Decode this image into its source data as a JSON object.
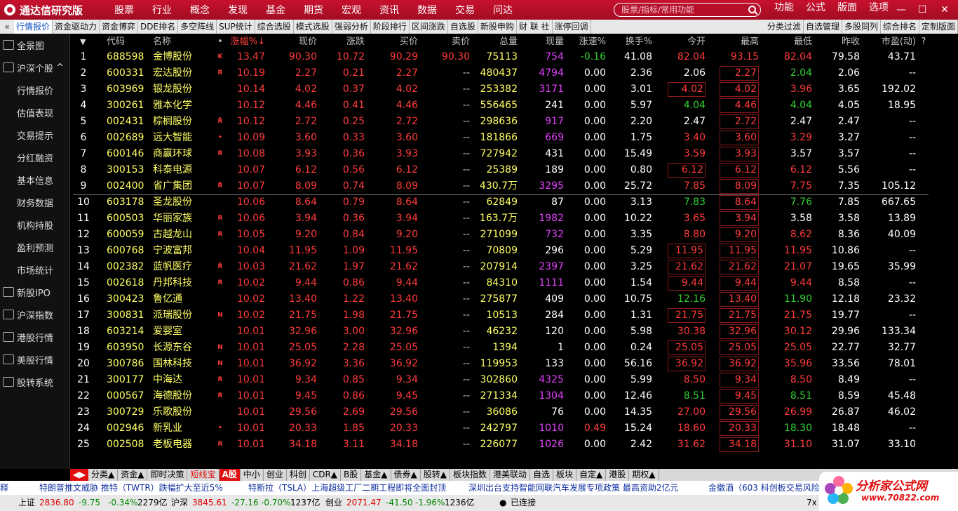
{
  "app": {
    "title": "通达信研究版",
    "menu": [
      "股票",
      "行业",
      "概念",
      "发现",
      "基金",
      "期货",
      "宏观",
      "资讯",
      "数据",
      "交易",
      "问达"
    ],
    "search_placeholder": "股票/指标/常用功能",
    "right_menu": [
      "功能",
      "公式",
      "版面",
      "选项"
    ]
  },
  "tabs_left": [
    "行情报价",
    "资金驱动力",
    "资金博弈",
    "DDE排名",
    "多空阵线",
    "SUP统计",
    "综合选股",
    "模式选股",
    "强弱分析",
    "阶段排行",
    "区间涨跌",
    "自选股",
    "新股申购",
    "财 联 社",
    "涨停回调"
  ],
  "tabs_right": [
    "分类过滤",
    "自选管理",
    "多股同列",
    "综合排名",
    "定制版面"
  ],
  "sidebar": [
    {
      "label": "全景图",
      "icon": "globe-icon",
      "sub": false
    },
    {
      "label": "沪深个股",
      "icon": "chart-icon",
      "sub": false,
      "expand": "^"
    },
    {
      "label": "行情报价",
      "sub": true
    },
    {
      "label": "估值表现",
      "sub": true
    },
    {
      "label": "交易提示",
      "sub": true
    },
    {
      "label": "分红融资",
      "sub": true
    },
    {
      "label": "基本信息",
      "sub": true
    },
    {
      "label": "财务数据",
      "sub": true
    },
    {
      "label": "机构持股",
      "sub": true
    },
    {
      "label": "盈利预测",
      "sub": true
    },
    {
      "label": "市场统计",
      "sub": true
    },
    {
      "label": "新股IPO",
      "icon": "ipo-icon",
      "sub": false
    },
    {
      "label": "沪深指数",
      "icon": "index-icon",
      "sub": false
    },
    {
      "label": "港股行情",
      "icon": "hk-icon",
      "sub": false
    },
    {
      "label": "美股行情",
      "icon": "us-icon",
      "sub": false
    },
    {
      "label": "股转系统",
      "icon": "neeq-icon",
      "sub": false
    }
  ],
  "columns": [
    "",
    "代码",
    "名称",
    "•",
    "涨幅%↓",
    "现价",
    "涨跌",
    "买价",
    "卖价",
    "总量",
    "现量",
    "涨速%",
    "换手%",
    "今开",
    "最高",
    "最低",
    "昨收",
    "市盈(动)",
    "?"
  ],
  "rows": [
    {
      "no": "1",
      "code": "688598",
      "name": "金博股份",
      "flag": "K",
      "pct": "13.47",
      "price": "90.30",
      "chg": "10.72",
      "bid": "90.29",
      "ask": "90.30",
      "vol": "75113",
      "cur": "754",
      "speed": "-0.16",
      "turn": "41.08",
      "open": "82.04",
      "high": "93.15",
      "low": "82.04",
      "prev": "79.58",
      "pe": "43.71"
    },
    {
      "no": "2",
      "code": "600331",
      "name": "宏达股份",
      "flag": "R",
      "pct": "10.19",
      "price": "2.27",
      "chg": "0.21",
      "bid": "2.27",
      "ask": "--",
      "vol": "480437",
      "cur": "4794",
      "speed": "0.00",
      "turn": "2.36",
      "open": "2.06",
      "high": "2.27",
      "low": "2.04",
      "prev": "2.06",
      "pe": "--"
    },
    {
      "no": "3",
      "code": "603969",
      "name": "银龙股份",
      "flag": "",
      "pct": "10.14",
      "price": "4.02",
      "chg": "0.37",
      "bid": "4.02",
      "ask": "--",
      "vol": "253382",
      "cur": "3171",
      "speed": "0.00",
      "turn": "3.01",
      "open": "4.02",
      "high": "4.02",
      "low": "3.96",
      "prev": "3.65",
      "pe": "192.02"
    },
    {
      "no": "4",
      "code": "300261",
      "name": "雅本化学",
      "flag": "",
      "pct": "10.12",
      "price": "4.46",
      "chg": "0.41",
      "bid": "4.46",
      "ask": "--",
      "vol": "556465",
      "cur": "241",
      "speed": "0.00",
      "turn": "5.97",
      "open": "4.04",
      "high": "4.46",
      "low": "4.04",
      "prev": "4.05",
      "pe": "18.95"
    },
    {
      "no": "5",
      "code": "002431",
      "name": "棕榈股份",
      "flag": "R̈",
      "pct": "10.12",
      "price": "2.72",
      "chg": "0.25",
      "bid": "2.72",
      "ask": "--",
      "vol": "298636",
      "cur": "917",
      "speed": "0.00",
      "turn": "2.20",
      "open": "2.47",
      "high": "2.72",
      "low": "2.47",
      "prev": "2.47",
      "pe": "--"
    },
    {
      "no": "6",
      "code": "002689",
      "name": "远大智能",
      "flag": "•",
      "pct": "10.09",
      "price": "3.60",
      "chg": "0.33",
      "bid": "3.60",
      "ask": "--",
      "vol": "181866",
      "cur": "669",
      "speed": "0.00",
      "turn": "1.75",
      "open": "3.40",
      "high": "3.60",
      "low": "3.29",
      "prev": "3.27",
      "pe": "--"
    },
    {
      "no": "7",
      "code": "600146",
      "name": "商赢环球",
      "flag": "R",
      "pct": "10.08",
      "price": "3.93",
      "chg": "0.36",
      "bid": "3.93",
      "ask": "--",
      "vol": "727942",
      "cur": "431",
      "speed": "0.00",
      "turn": "15.49",
      "open": "3.59",
      "high": "3.93",
      "low": "3.57",
      "prev": "3.57",
      "pe": "--"
    },
    {
      "no": "8",
      "code": "300153",
      "name": "科泰电源",
      "flag": "",
      "pct": "10.07",
      "price": "6.12",
      "chg": "0.56",
      "bid": "6.12",
      "ask": "--",
      "vol": "25389",
      "cur": "189",
      "speed": "0.00",
      "turn": "0.80",
      "open": "6.12",
      "high": "6.12",
      "low": "6.12",
      "prev": "5.56",
      "pe": "--"
    },
    {
      "no": "9",
      "code": "002400",
      "name": "省广集团",
      "flag": "R̈",
      "pct": "10.07",
      "price": "8.09",
      "chg": "0.74",
      "bid": "8.09",
      "ask": "--",
      "vol": "430.7万",
      "cur": "3295",
      "speed": "0.00",
      "turn": "25.72",
      "open": "7.85",
      "high": "8.09",
      "low": "7.75",
      "prev": "7.35",
      "pe": "105.12"
    },
    {
      "no": "10",
      "code": "603178",
      "name": "圣龙股份",
      "flag": "",
      "pct": "10.06",
      "price": "8.64",
      "chg": "0.79",
      "bid": "8.64",
      "ask": "--",
      "vol": "62849",
      "cur": "87",
      "speed": "0.00",
      "turn": "3.13",
      "open": "7.83",
      "high": "8.64",
      "low": "7.76",
      "prev": "7.85",
      "pe": "667.65"
    },
    {
      "no": "11",
      "code": "600503",
      "name": "华丽家族",
      "flag": "R",
      "pct": "10.06",
      "price": "3.94",
      "chg": "0.36",
      "bid": "3.94",
      "ask": "--",
      "vol": "163.7万",
      "cur": "1982",
      "speed": "0.00",
      "turn": "10.22",
      "open": "3.65",
      "high": "3.94",
      "low": "3.58",
      "prev": "3.58",
      "pe": "13.89"
    },
    {
      "no": "12",
      "code": "600059",
      "name": "古越龙山",
      "flag": "R",
      "pct": "10.05",
      "price": "9.20",
      "chg": "0.84",
      "bid": "9.20",
      "ask": "--",
      "vol": "271099",
      "cur": "732",
      "speed": "0.00",
      "turn": "3.35",
      "open": "8.80",
      "high": "9.20",
      "low": "8.62",
      "prev": "8.36",
      "pe": "40.09"
    },
    {
      "no": "13",
      "code": "600768",
      "name": "宁波富邦",
      "flag": "",
      "pct": "10.04",
      "price": "11.95",
      "chg": "1.09",
      "bid": "11.95",
      "ask": "--",
      "vol": "70809",
      "cur": "296",
      "speed": "0.00",
      "turn": "5.29",
      "open": "11.95",
      "high": "11.95",
      "low": "11.95",
      "prev": "10.86",
      "pe": "--"
    },
    {
      "no": "14",
      "code": "002382",
      "name": "蓝帆医疗",
      "flag": "R̈",
      "pct": "10.03",
      "price": "21.62",
      "chg": "1.97",
      "bid": "21.62",
      "ask": "--",
      "vol": "207914",
      "cur": "2397",
      "speed": "0.00",
      "turn": "3.25",
      "open": "21.62",
      "high": "21.62",
      "low": "21.07",
      "prev": "19.65",
      "pe": "35.99"
    },
    {
      "no": "15",
      "code": "002618",
      "name": "丹邦科技",
      "flag": "R",
      "pct": "10.02",
      "price": "9.44",
      "chg": "0.86",
      "bid": "9.44",
      "ask": "--",
      "vol": "84310",
      "cur": "1111",
      "speed": "0.00",
      "turn": "1.54",
      "open": "9.44",
      "high": "9.44",
      "low": "9.44",
      "prev": "8.58",
      "pe": "--"
    },
    {
      "no": "16",
      "code": "300423",
      "name": "鲁亿通",
      "flag": "",
      "pct": "10.02",
      "price": "13.40",
      "chg": "1.22",
      "bid": "13.40",
      "ask": "--",
      "vol": "275877",
      "cur": "409",
      "speed": "0.00",
      "turn": "10.75",
      "open": "12.16",
      "high": "13.40",
      "low": "11.90",
      "prev": "12.18",
      "pe": "23.32"
    },
    {
      "no": "17",
      "code": "300831",
      "name": "派瑞股份",
      "flag": "N",
      "pct": "10.02",
      "price": "21.75",
      "chg": "1.98",
      "bid": "21.75",
      "ask": "--",
      "vol": "10513",
      "cur": "284",
      "speed": "0.00",
      "turn": "1.31",
      "open": "21.75",
      "high": "21.75",
      "low": "21.75",
      "prev": "19.77",
      "pe": "--"
    },
    {
      "no": "18",
      "code": "603214",
      "name": "爱婴室",
      "flag": "",
      "pct": "10.01",
      "price": "32.96",
      "chg": "3.00",
      "bid": "32.96",
      "ask": "--",
      "vol": "46232",
      "cur": "120",
      "speed": "0.00",
      "turn": "5.98",
      "open": "30.38",
      "high": "32.96",
      "low": "30.12",
      "prev": "29.96",
      "pe": "133.34"
    },
    {
      "no": "19",
      "code": "603950",
      "name": "长源东谷",
      "flag": "N",
      "pct": "10.01",
      "price": "25.05",
      "chg": "2.28",
      "bid": "25.05",
      "ask": "--",
      "vol": "1394",
      "cur": "1",
      "speed": "0.00",
      "turn": "0.24",
      "open": "25.05",
      "high": "25.05",
      "low": "25.05",
      "prev": "22.77",
      "pe": "32.77"
    },
    {
      "no": "20",
      "code": "300786",
      "name": "国林科技",
      "flag": "N",
      "pct": "10.01",
      "price": "36.92",
      "chg": "3.36",
      "bid": "36.92",
      "ask": "--",
      "vol": "119953",
      "cur": "133",
      "speed": "0.00",
      "turn": "56.16",
      "open": "36.92",
      "high": "36.92",
      "low": "35.96",
      "prev": "33.56",
      "pe": "78.01"
    },
    {
      "no": "21",
      "code": "300177",
      "name": "中海达",
      "flag": "R",
      "pct": "10.01",
      "price": "9.34",
      "chg": "0.85",
      "bid": "9.34",
      "ask": "--",
      "vol": "302860",
      "cur": "4325",
      "speed": "0.00",
      "turn": "5.99",
      "open": "8.50",
      "high": "9.34",
      "low": "8.50",
      "prev": "8.49",
      "pe": "--"
    },
    {
      "no": "22",
      "code": "000567",
      "name": "海德股份",
      "flag": "R",
      "pct": "10.01",
      "price": "9.45",
      "chg": "0.86",
      "bid": "9.45",
      "ask": "--",
      "vol": "271334",
      "cur": "1304",
      "speed": "0.00",
      "turn": "12.46",
      "open": "8.51",
      "high": "9.45",
      "low": "8.51",
      "prev": "8.59",
      "pe": "45.48"
    },
    {
      "no": "23",
      "code": "300729",
      "name": "乐歌股份",
      "flag": "",
      "pct": "10.01",
      "price": "29.56",
      "chg": "2.69",
      "bid": "29.56",
      "ask": "--",
      "vol": "36086",
      "cur": "76",
      "speed": "0.00",
      "turn": "14.35",
      "open": "27.00",
      "high": "29.56",
      "low": "26.99",
      "prev": "26.87",
      "pe": "46.02"
    },
    {
      "no": "24",
      "code": "002946",
      "name": "新乳业",
      "flag": "•",
      "pct": "10.01",
      "price": "20.33",
      "chg": "1.85",
      "bid": "20.33",
      "ask": "--",
      "vol": "242797",
      "cur": "1010",
      "speed": "0.49",
      "turn": "15.24",
      "open": "18.60",
      "high": "20.33",
      "low": "18.30",
      "prev": "18.48",
      "pe": "--"
    },
    {
      "no": "25",
      "code": "002508",
      "name": "老板电器",
      "flag": "R",
      "pct": "10.01",
      "price": "34.18",
      "chg": "3.11",
      "bid": "34.18",
      "ask": "--",
      "vol": "226077",
      "cur": "1026",
      "speed": "0.00",
      "turn": "2.42",
      "open": "31.62",
      "high": "34.18",
      "low": "31.10",
      "prev": "31.07",
      "pe": "33.10"
    }
  ],
  "categories": [
    "分类▲",
    "资金▲",
    "即时决策",
    "短线宝",
    "A股",
    "中小",
    "创业",
    "科创",
    "CDR▲",
    "B股",
    "基金▲",
    "债券▲",
    "股转▲",
    "板块指数",
    "港美联动",
    "自选",
    "板块",
    "自定▲",
    "港股",
    "期权▲"
  ],
  "ticker": [
    "释",
    "特朗普推文威胁 推特（TWTR）跌幅扩大至近5%",
    "特斯拉（TSLA）上海超级工厂二期工程即将全面封顶",
    "深圳出台支持智能网联汽车发展专项政策 最高资助2亿元",
    "金徽酒（603 科创板交易风险"
  ],
  "status": {
    "sh_label": "上证",
    "sh_val": "2836.80",
    "sh_chg": "-9.75",
    "sh_pct": "-0.34%",
    "sh_amt": "2279亿",
    "sz_label": "沪深",
    "sz_val": "3845.61",
    "sz_chg": "-27.16",
    "sz_pct": "-0.70%",
    "sz_amt": "1237亿",
    "cy_label": "创业",
    "cy_val": "2071.47",
    "cy_chg": "-41.50",
    "cy_pct": "-1.96%",
    "cy_amt": "1236亿",
    "conn": "已连接",
    "corner": "7x"
  },
  "watermark": {
    "title": "分析家公式网",
    "url": "www.70822.com"
  }
}
